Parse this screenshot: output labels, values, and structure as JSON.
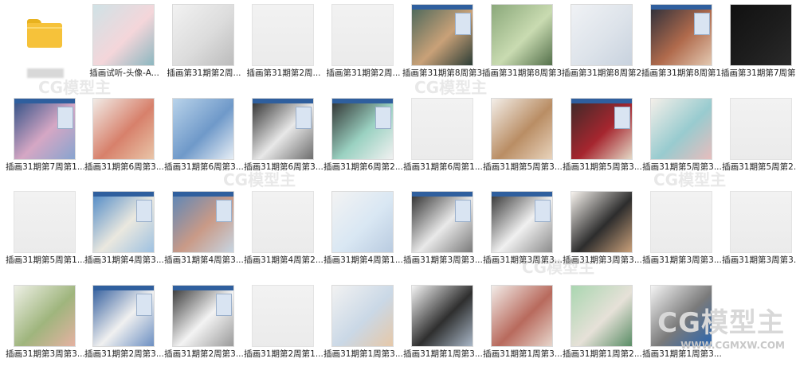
{
  "watermark": {
    "brand": "CG模型主",
    "site": "WWW.CGMXW.COM"
  },
  "items": [
    {
      "type": "folder",
      "label": ""
    },
    {
      "type": "image",
      "label": "插画试听-头像-A...",
      "colors": [
        "#cfe2e6",
        "#f4d6da",
        "#8cb7c0"
      ]
    },
    {
      "type": "image",
      "label": "插画第31期第2周...",
      "colors": [
        "#f2f2f2",
        "#dcdcdc",
        "#bcbcbc"
      ]
    },
    {
      "type": "image",
      "label": "插画第31期第2周...",
      "colors": [
        "#efefef",
        "#e5e5e5",
        "#dddddd"
      ]
    },
    {
      "type": "image",
      "label": "插画第31期第2周...",
      "colors": [
        "#efefef",
        "#e5e5e5",
        "#dddddd"
      ]
    },
    {
      "type": "image",
      "label": "插画第31期第8周第3...",
      "colors": [
        "#48665a",
        "#c9a178",
        "#2c3d36"
      ]
    },
    {
      "type": "image",
      "label": "插画第31期第8周第3...",
      "colors": [
        "#8aa87a",
        "#c9dbb1",
        "#54704b"
      ]
    },
    {
      "type": "image",
      "label": "插画第31期第8周第2...",
      "colors": [
        "#f0f2f5",
        "#dde3ea",
        "#c8d2de"
      ]
    },
    {
      "type": "image",
      "label": "插画第31期第8周第1...",
      "colors": [
        "#2a2e3a",
        "#b06a4c",
        "#e3c9b2"
      ]
    },
    {
      "type": "image",
      "label": "插画第31期第7周第2...",
      "colors": [
        "#111111",
        "#1d1d1d",
        "#2a2a2a"
      ]
    },
    {
      "type": "image",
      "label": "插画31期第7周第1...",
      "colors": [
        "#2e4f85",
        "#d5a7c4",
        "#87a4cf"
      ]
    },
    {
      "type": "image",
      "label": "插画31期第6周第3...",
      "colors": [
        "#f1ebe6",
        "#d7806b",
        "#e9c5a8"
      ]
    },
    {
      "type": "image",
      "label": "插画31期第6周第3...",
      "colors": [
        "#b9d3ea",
        "#6f99c9",
        "#e7eef5"
      ]
    },
    {
      "type": "image",
      "label": "插画31期第6周第3...",
      "colors": [
        "#2b2b2b",
        "#e8e8e8",
        "#6d6d6d"
      ]
    },
    {
      "type": "image",
      "label": "插画31期第6周第2...",
      "colors": [
        "#2d2d2d",
        "#9ad1c1",
        "#f1f1f1"
      ]
    },
    {
      "type": "image",
      "label": "插画31期第6周第1...",
      "colors": [
        "#efefef",
        "#e5e5e5",
        "#dddddd"
      ]
    },
    {
      "type": "image",
      "label": "插画31期第5周第3...",
      "colors": [
        "#f3eee8",
        "#b98d64",
        "#e8d3bc"
      ]
    },
    {
      "type": "image",
      "label": "插画31期第5周第3...",
      "colors": [
        "#3a2a28",
        "#a6262f",
        "#e3d8c6"
      ]
    },
    {
      "type": "image",
      "label": "插画31期第5周第3...",
      "colors": [
        "#f4efe9",
        "#98cbcf",
        "#e7bdbd"
      ]
    },
    {
      "type": "image",
      "label": "插画31期第5周第2...",
      "colors": [
        "#efefef",
        "#e5e5e5",
        "#dddddd"
      ]
    },
    {
      "type": "image",
      "label": "插画31期第5周第1...",
      "colors": [
        "#efefef",
        "#e5e5e5",
        "#dddddd"
      ]
    },
    {
      "type": "image",
      "label": "插画31期第4周第3...",
      "colors": [
        "#4d88c6",
        "#eae8df",
        "#9ec1e1"
      ]
    },
    {
      "type": "image",
      "label": "插画31期第4周第3...",
      "colors": [
        "#5a86b9",
        "#c99a87",
        "#c7d5e2"
      ]
    },
    {
      "type": "image",
      "label": "插画31期第4周第2...",
      "colors": [
        "#efefef",
        "#e5e5e5",
        "#dddddd"
      ]
    },
    {
      "type": "image",
      "label": "插画31期第4周第1...",
      "colors": [
        "#f3f3f3",
        "#d9e7f3",
        "#b9cbe0"
      ]
    },
    {
      "type": "image",
      "label": "插画31期第3周第3...",
      "colors": [
        "#2a2a2a",
        "#e9e9e9",
        "#7a7a7a"
      ]
    },
    {
      "type": "image",
      "label": "插画31期第3周第3...",
      "colors": [
        "#303030",
        "#f0f0f0",
        "#8c8c8c"
      ]
    },
    {
      "type": "image",
      "label": "插画31期第3周第3...",
      "colors": [
        "#f7f3ee",
        "#2d2d2d",
        "#c9a07a"
      ]
    },
    {
      "type": "image",
      "label": "插画31期第3周第3...",
      "colors": [
        "#efefef",
        "#e5e5e5",
        "#dddddd"
      ]
    },
    {
      "type": "image",
      "label": "插画31期第3周第3...",
      "colors": [
        "#efefef",
        "#e5e5e5",
        "#dddddd"
      ]
    },
    {
      "type": "image",
      "label": "插画31期第3周第3...",
      "colors": [
        "#eef0e6",
        "#9fb57d",
        "#e5b2a2"
      ]
    },
    {
      "type": "image",
      "label": "插画31期第2周第3...",
      "colors": [
        "#2d5a9b",
        "#f0f0f0",
        "#6c8fc2"
      ]
    },
    {
      "type": "image",
      "label": "插画31期第2周第3...",
      "colors": [
        "#333333",
        "#f3f3f3",
        "#9a9a9a"
      ]
    },
    {
      "type": "image",
      "label": "插画31期第2周第1...",
      "colors": [
        "#efefef",
        "#e5e5e5",
        "#dddddd"
      ]
    },
    {
      "type": "image",
      "label": "插画31期第1周第3...",
      "colors": [
        "#f2f2f2",
        "#cad8e6",
        "#e6c8a8"
      ]
    },
    {
      "type": "image",
      "label": "插画31期第1周第3...",
      "colors": [
        "#f4f4f4",
        "#2f2f2f",
        "#a9b7c7"
      ]
    },
    {
      "type": "image",
      "label": "插画31期第1周第3...",
      "colors": [
        "#f2ece8",
        "#b86a5d",
        "#e7d6cc"
      ]
    },
    {
      "type": "image",
      "label": "插画31期第1周第2...",
      "colors": [
        "#a9d6b0",
        "#e6e1d8",
        "#5a8d66"
      ]
    },
    {
      "type": "image",
      "label": "插画31期第1周第3...",
      "colors": [
        "#f4f4f4",
        "#7a7a7a",
        "#2a66b0"
      ]
    }
  ]
}
